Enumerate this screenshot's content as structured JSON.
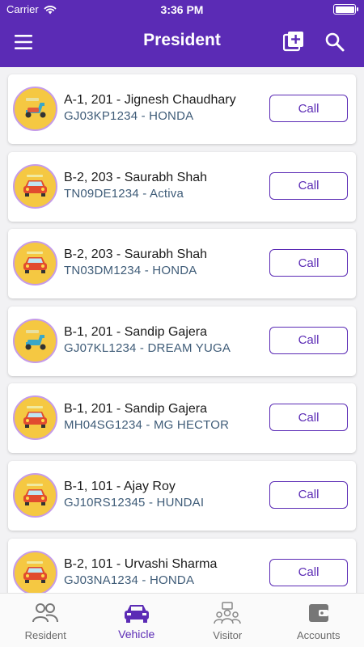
{
  "status_bar": {
    "carrier": "Carrier",
    "time": "3:36 PM"
  },
  "header": {
    "title": "President",
    "icons": [
      "menu-icon",
      "add-square-icon",
      "search-icon"
    ]
  },
  "vehicles": [
    {
      "name": "A-1, 201 - Jignesh Chaudhary",
      "vehicle": "GJ03KP1234 - HONDA",
      "type": "scooter",
      "call_label": "Call"
    },
    {
      "name": "B-2, 203 - Saurabh Shah",
      "vehicle": "TN09DE1234 - Activa",
      "type": "car",
      "call_label": "Call"
    },
    {
      "name": "B-2, 203 - Saurabh Shah",
      "vehicle": "TN03DM1234 - HONDA",
      "type": "car",
      "call_label": "Call"
    },
    {
      "name": "B-1, 201 - Sandip Gajera",
      "vehicle": "GJ07KL1234 - DREAM YUGA",
      "type": "scooter",
      "call_label": "Call"
    },
    {
      "name": "B-1, 201 - Sandip Gajera",
      "vehicle": "MH04SG1234 - MG HECTOR",
      "type": "car",
      "call_label": "Call"
    },
    {
      "name": "B-1, 101 - Ajay Roy",
      "vehicle": "GJ10RS12345 - HUNDAI",
      "type": "car",
      "call_label": "Call"
    },
    {
      "name": "B-2, 101 - Urvashi Sharma",
      "vehicle": "GJ03NA1234 - HONDA",
      "type": "car",
      "call_label": "Call"
    }
  ],
  "tabs": [
    {
      "label": "Resident",
      "icon": "people-icon",
      "active": false
    },
    {
      "label": "Vehicle",
      "icon": "car-icon",
      "active": true
    },
    {
      "label": "Visitor",
      "icon": "visitor-icon",
      "active": false
    },
    {
      "label": "Accounts",
      "icon": "wallet-icon",
      "active": false
    }
  ],
  "colors": {
    "primary": "#5b2bb5",
    "avatar_bg": "#f5c842",
    "avatar_border": "#c59be8",
    "vehicle_text": "#3f5c78"
  }
}
